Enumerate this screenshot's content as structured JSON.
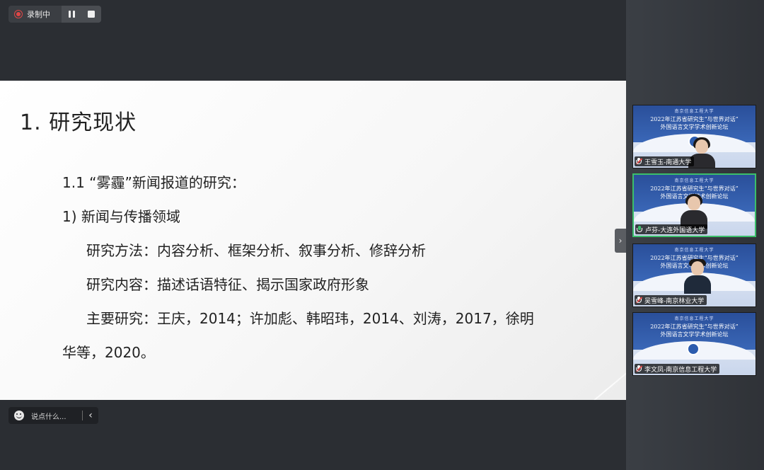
{
  "recording": {
    "status_label": "录制中",
    "pause_icon": "pause-icon",
    "stop_icon": "stop-icon"
  },
  "slide": {
    "title": "1. 研究现状",
    "lines": [
      "1.1 “雾霾”新闻报道的研究：",
      "1)  新闻与传播领域",
      "研究方法：内容分析、框架分析、叙事分析、修辞分析",
      "研究内容：描述话语特征、揭示国家政府形象",
      "主要研究：王庆，2014；许加彪、韩昭玮，2014、刘涛，2017，徐明",
      "华等，2020。"
    ]
  },
  "chat": {
    "placeholder": "说点什么...",
    "emoji_icon": "emoji-icon",
    "collapse_icon": "chevron-left-icon"
  },
  "participants": [
    {
      "name": "王雪玉-南通大学",
      "mic": "muted"
    },
    {
      "name": "卢芬-大连外国语大学",
      "mic": "on"
    },
    {
      "name": "吴雪峰-南京林业大学",
      "mic": "muted"
    },
    {
      "name": "李文凤-南京信息工程大学",
      "mic": "muted"
    }
  ],
  "tile_banner": {
    "school": "南京信息工程大学",
    "title_line1": "2022年江苏省研究生“与世界对话”",
    "title_line2": "外国语言文学学术创新论坛"
  },
  "colors": {
    "accent_active": "#3bbf6a",
    "record_red": "#e04646",
    "banner_blue": "#2a4f9a"
  }
}
